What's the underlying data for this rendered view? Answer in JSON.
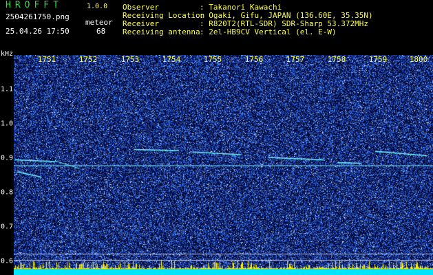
{
  "header": {
    "app_name": "HROFFT",
    "version": "1.0.0",
    "filename": "2504261750.png",
    "timestamp": "25.04.26 17:50",
    "meteor_label": "meteor",
    "meteor_count": "68",
    "info": [
      {
        "key": "Observer",
        "value": ": Takanori Kawachi"
      },
      {
        "key": "Receiving Location",
        "value": ": Ogaki, Gifu, JAPAN (136.60E, 35.35N)"
      },
      {
        "key": "Receiver",
        "value": ": R820T2(RTL-SDR) SDR-Sharp 53.372MHz"
      },
      {
        "key": "Receiving antenna",
        "value": ": 2el-HB9CV Vertical (el. E-W)"
      }
    ]
  },
  "chart_data": {
    "type": "heatmap",
    "ylabel": "kHz",
    "x_ticks": [
      "1751",
      "1752",
      "1753",
      "1754",
      "1755",
      "1756",
      "1757",
      "1758",
      "1759",
      "1800"
    ],
    "y_ticks": [
      "1.1",
      "1.0",
      "0.9",
      "0.8",
      "0.7",
      "0.6"
    ],
    "y_tick_values": [
      1.1,
      1.0,
      0.9,
      0.8,
      0.7,
      0.6
    ],
    "ylim": [
      0.58,
      1.2
    ],
    "carrier_khz": 0.878,
    "reference_lines_khz": [
      0.621,
      0.603
    ],
    "colors": {
      "background": "#020a3a",
      "noise": "#3a6cff",
      "echo": "#6ff0ff",
      "carrier": "#7fe8ff",
      "ref_line": "#c8d0ff",
      "bottom_bar": "#00e5ff",
      "bottom_spikes": "#ffee00"
    }
  }
}
